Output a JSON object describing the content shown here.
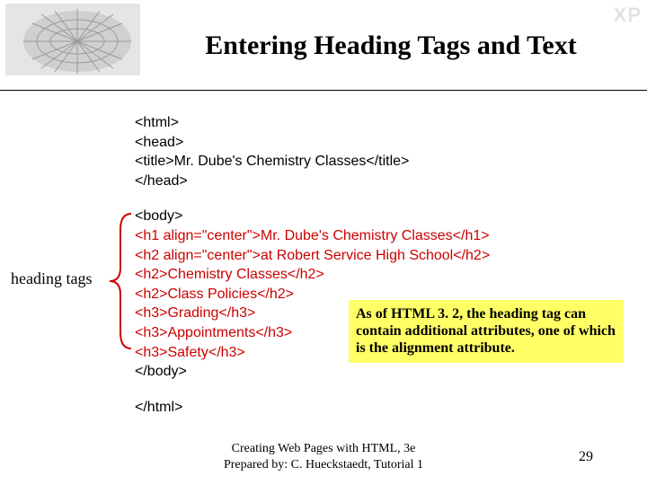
{
  "header": {
    "title": "Entering Heading Tags and Text",
    "xp_badge": "XP"
  },
  "code": {
    "black_lines_top": [
      "<html>",
      "<head>",
      "<title>Mr. Dube's Chemistry Classes</title>",
      "</head>"
    ],
    "body_open": "<body>",
    "red_lines": [
      "<h1 align=\"center\">Mr. Dube's Chemistry Classes</h1>",
      "<h2 align=\"center\">at Robert Service High School</h2>",
      "<h2>Chemistry Classes</h2>",
      "<h2>Class Policies</h2>",
      "<h3>Grading</h3>",
      "<h3>Appointments</h3>",
      "<h3>Safety</h3>"
    ],
    "body_close": "</body>",
    "html_close": "</html>"
  },
  "annotation": {
    "left_label": "heading tags",
    "callout": "As of HTML 3. 2, the heading tag can contain additional attributes, one of which is the alignment attribute."
  },
  "footer": {
    "line1": "Creating Web Pages with HTML, 3e",
    "line2": "Prepared by: C. Hueckstaedt, Tutorial 1",
    "page": "29"
  }
}
